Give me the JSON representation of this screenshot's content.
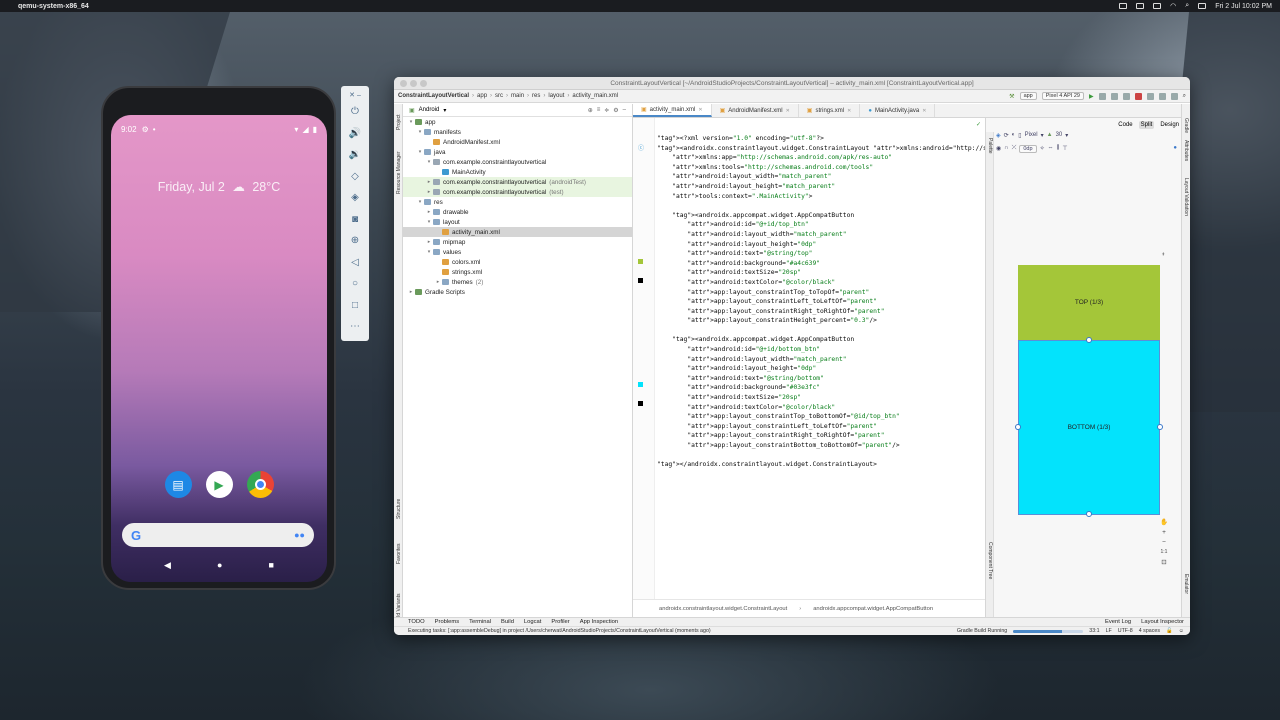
{
  "menubar": {
    "app_name": "qemu-system-x86_64",
    "datetime": "Fri 2 Jul  10:02 PM"
  },
  "phone": {
    "time": "9:02",
    "date": "Friday, Jul 2",
    "weather": "28°C",
    "dock": [
      "messages-app",
      "play-store-app",
      "chrome-app"
    ],
    "search_logo": "G"
  },
  "ide": {
    "window_title": "ConstraintLayoutVertical [~/AndroidStudioProjects/ConstraintLayoutVertical] – activity_main.xml [ConstraintLayoutVertical.app]",
    "breadcrumb": [
      "ConstraintLayoutVertical",
      "app",
      "src",
      "main",
      "res",
      "layout",
      "activity_main.xml"
    ],
    "run_config": "app",
    "device": "Pixel 4 API 29",
    "project_view": "Android",
    "tree": [
      {
        "label": "app",
        "depth": 0,
        "arrow": "▾",
        "color": "#6a9a5b"
      },
      {
        "label": "manifests",
        "depth": 1,
        "arrow": "▾",
        "color": "#8aa7c4"
      },
      {
        "label": "AndroidManifest.xml",
        "depth": 2,
        "arrow": "",
        "color": "#e0a040"
      },
      {
        "label": "java",
        "depth": 1,
        "arrow": "▾",
        "color": "#8aa7c4"
      },
      {
        "label": "com.example.constraintlayoutvertical",
        "depth": 2,
        "arrow": "▾",
        "color": "#9aa7b4"
      },
      {
        "label": "MainActivity",
        "depth": 3,
        "arrow": "",
        "color": "#3d9ad1"
      },
      {
        "label": "com.example.constraintlayoutvertical",
        "suffix": "(androidTest)",
        "depth": 2,
        "arrow": "▸",
        "color": "#9aa7b4",
        "green": true
      },
      {
        "label": "com.example.constraintlayoutvertical",
        "suffix": "(test)",
        "depth": 2,
        "arrow": "▸",
        "color": "#9aa7b4",
        "green": true
      },
      {
        "label": "res",
        "depth": 1,
        "arrow": "▾",
        "color": "#8aa7c4"
      },
      {
        "label": "drawable",
        "depth": 2,
        "arrow": "▸",
        "color": "#8aa7c4"
      },
      {
        "label": "layout",
        "depth": 2,
        "arrow": "▾",
        "color": "#8aa7c4"
      },
      {
        "label": "activity_main.xml",
        "depth": 3,
        "arrow": "",
        "color": "#e0a040",
        "selected": true
      },
      {
        "label": "mipmap",
        "depth": 2,
        "arrow": "▸",
        "color": "#8aa7c4"
      },
      {
        "label": "values",
        "depth": 2,
        "arrow": "▾",
        "color": "#8aa7c4"
      },
      {
        "label": "colors.xml",
        "depth": 3,
        "arrow": "",
        "color": "#e0a040"
      },
      {
        "label": "strings.xml",
        "depth": 3,
        "arrow": "",
        "color": "#e0a040"
      },
      {
        "label": "themes",
        "suffix": "(2)",
        "depth": 3,
        "arrow": "▸",
        "color": "#8aa7c4"
      },
      {
        "label": "Gradle Scripts",
        "depth": 0,
        "arrow": "▸",
        "color": "#6a9a5b"
      }
    ],
    "tabs": [
      "activity_main.xml",
      "AndroidManifest.xml",
      "strings.xml",
      "MainActivity.java"
    ],
    "code_lines": [
      "<?xml version=\"1.0\" encoding=\"utf-8\"?>",
      "<androidx.constraintlayout.widget.ConstraintLayout xmlns:android=\"http://schemas.android.c",
      "    xmlns:app=\"http://schemas.android.com/apk/res-auto\"",
      "    xmlns:tools=\"http://schemas.android.com/tools\"",
      "    android:layout_width=\"match_parent\"",
      "    android:layout_height=\"match_parent\"",
      "    tools:context=\".MainActivity\">",
      "",
      "    <androidx.appcompat.widget.AppCompatButton",
      "        android:id=\"@+id/top_btn\"",
      "        android:layout_width=\"match_parent\"",
      "        android:layout_height=\"0dp\"",
      "        android:text=\"@string/top\"",
      "        android:background=\"#a4c639\"",
      "        android:textSize=\"20sp\"",
      "        android:textColor=\"@color/black\"",
      "        app:layout_constraintTop_toTopOf=\"parent\"",
      "        app:layout_constraintLeft_toLeftOf=\"parent\"",
      "        app:layout_constraintRight_toRightOf=\"parent\"",
      "        app:layout_constraintHeight_percent=\"0.3\"/>",
      "",
      "    <androidx.appcompat.widget.AppCompatButton",
      "        android:id=\"@+id/bottom_btn\"",
      "        android:layout_width=\"match_parent\"",
      "        android:layout_height=\"0dp\"",
      "        android:text=\"@string/bottom\"",
      "        android:background=\"#03e3fc\"",
      "        android:textSize=\"20sp\"",
      "        android:textColor=\"@color/black\"",
      "        app:layout_constraintTop_toBottomOf=\"@id/top_btn\"",
      "        app:layout_constraintLeft_toLeftOf=\"parent\"",
      "        app:layout_constraintRight_toRightOf=\"parent\"",
      "        app:layout_constraintBottom_toBottomOf=\"parent\"/>",
      "",
      "</androidx.constraintlayout.widget.ConstraintLayout>"
    ],
    "swatches": {
      "top": "#a4c639",
      "bottom": "#03e3fc"
    },
    "code_breadcrumb": [
      "androidx.constraintlayout.widget.ConstraintLayout",
      "androidx.appcompat.widget.AppCompatButton"
    ],
    "design": {
      "modes": [
        "Code",
        "Split",
        "Design"
      ],
      "active_mode": "Split",
      "device": "Pixel",
      "api": "30",
      "margin": "0dp",
      "top_button": "TOP (1/3)",
      "bottom_button": "BOTTOM (1/3)",
      "zoom_ratio": "1:1"
    },
    "side_left": [
      "Project",
      "Resource Manager",
      "Structure",
      "Favorites",
      "Build Variants"
    ],
    "side_right": [
      "Gradle",
      "Attributes",
      "Layout Validation",
      "Emulator"
    ],
    "design_side": [
      "Palette",
      "Component Tree"
    ],
    "tool_windows": [
      "TODO",
      "Problems",
      "Terminal",
      "Build",
      "Logcat",
      "Profiler",
      "App Inspection"
    ],
    "tool_windows_right": [
      "Event Log",
      "Layout Inspector"
    ],
    "status_text": "Executing tasks: [:app:assembleDebug] in project /Users/cherwat/AndroidStudioProjects/ConstraintLayoutVertical (moments ago)",
    "gradle_status": "Gradle Build Running",
    "cursor_pos": "33:1",
    "line_sep": "LF",
    "encoding": "UTF-8",
    "indent": "4 spaces"
  }
}
